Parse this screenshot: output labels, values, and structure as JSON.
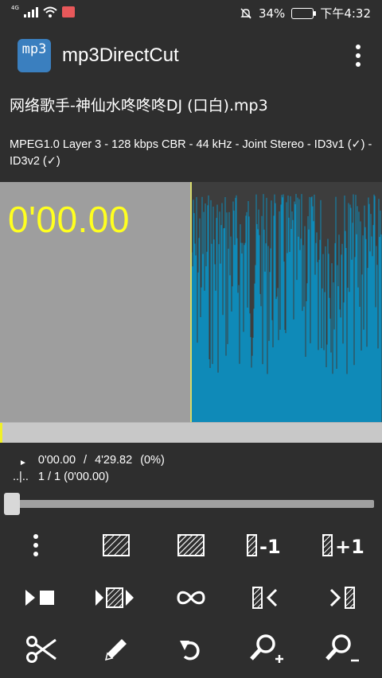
{
  "status_bar": {
    "network_label": "4G",
    "battery_percent": "34%",
    "time": "下午4:32"
  },
  "app": {
    "icon_text": "mp3",
    "title": "mp3DirectCut"
  },
  "file": {
    "name": "网络歌手-神仙水咚咚咚DJ (口白).mp3",
    "info": "MPEG1.0 Layer 3 - 128 kbps CBR - 44 kHz - Joint Stereo - ID3v1 (✓) - ID3v2 (✓)"
  },
  "waveform": {
    "position_display": "0'00.00",
    "wave_color": "#0f8ab8",
    "background_color": "#9e9e9e",
    "cursor_color": "#d5d86a",
    "time_color": "#ffff20"
  },
  "playback": {
    "play_symbol": "►",
    "current": "0'00.00",
    "separator": "/",
    "total": "4'29.82",
    "percent": "(0%)"
  },
  "selection": {
    "marker": "..|..",
    "counter": "1 / 1 (0'00.00)"
  },
  "seek": {
    "progress_fraction": 0.0
  },
  "toolbar": {
    "row1": [
      {
        "icon": "more-vertical-icon"
      },
      {
        "icon": "selection-hatch-icon"
      },
      {
        "icon": "select-all-hatch-icon"
      },
      {
        "icon": "selection-minus-one-icon",
        "label": "-1"
      },
      {
        "icon": "selection-plus-one-icon",
        "label": "+1"
      }
    ],
    "row2": [
      {
        "icon": "play-stop-icon"
      },
      {
        "icon": "play-selection-icon"
      },
      {
        "icon": "loop-icon"
      },
      {
        "icon": "go-selection-start-icon"
      },
      {
        "icon": "go-selection-end-icon"
      }
    ],
    "row3": [
      {
        "icon": "cut-icon"
      },
      {
        "icon": "edit-pencil-icon"
      },
      {
        "icon": "undo-icon"
      },
      {
        "icon": "zoom-in-icon"
      },
      {
        "icon": "zoom-out-icon"
      }
    ]
  }
}
